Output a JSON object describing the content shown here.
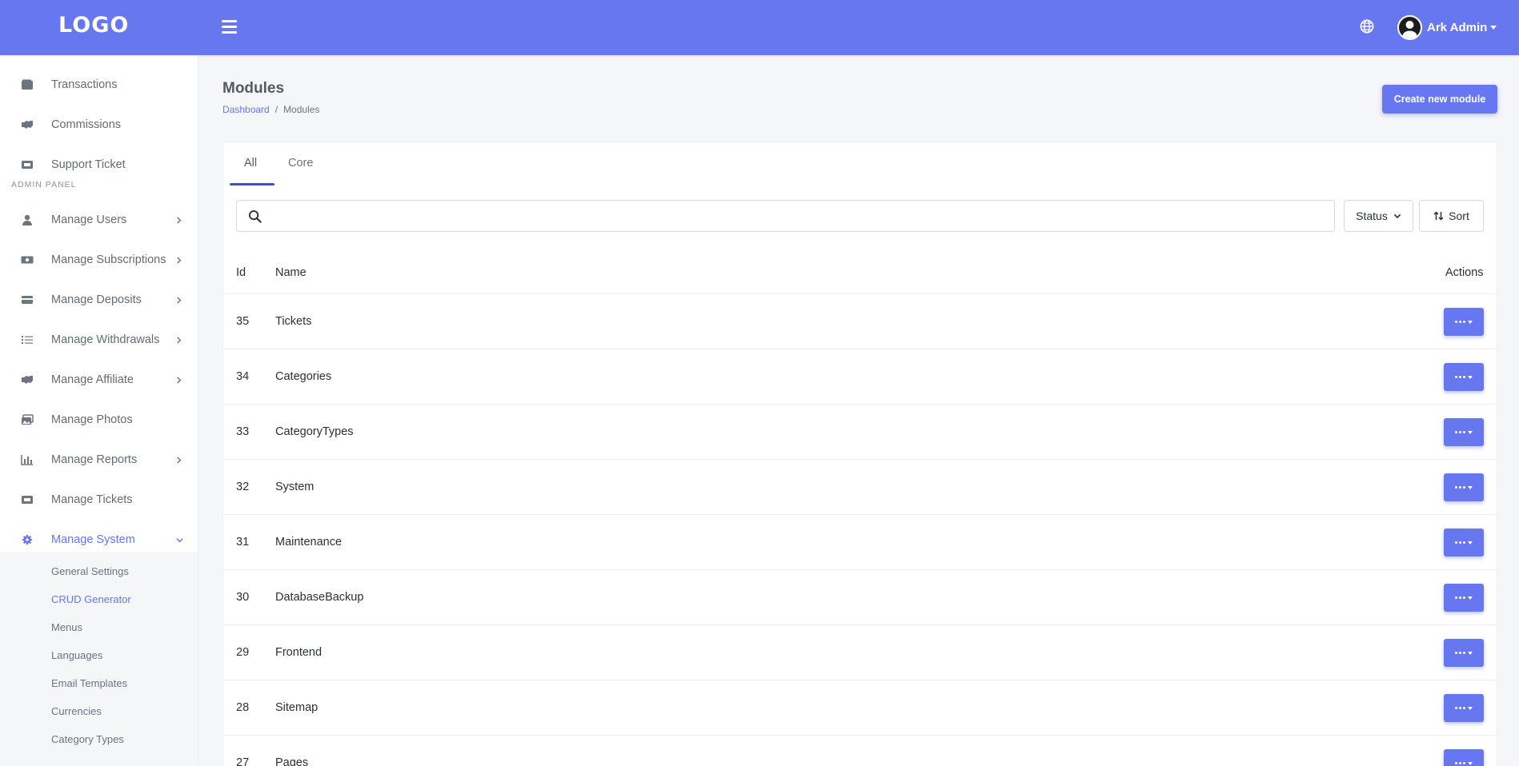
{
  "topbar": {
    "logo": "LOGO",
    "user_name": "Ark Admin",
    "accent": "#6777ef"
  },
  "sidebar": {
    "items_top": [
      {
        "label": "Transactions",
        "icon": "wallet-icon"
      },
      {
        "label": "Commissions",
        "icon": "handshake-icon"
      },
      {
        "label": "Support Ticket",
        "icon": "ticket-icon"
      }
    ],
    "section": "ADMIN PANEL",
    "items": [
      {
        "label": "Manage Users",
        "icon": "user-icon"
      },
      {
        "label": "Manage Subscriptions",
        "icon": "money-icon"
      },
      {
        "label": "Manage Deposits",
        "icon": "credit-card-icon"
      },
      {
        "label": "Manage Withdrawals",
        "icon": "list-icon"
      },
      {
        "label": "Manage Affiliate",
        "icon": "handshake-icon"
      },
      {
        "label": "Manage Photos",
        "icon": "images-icon"
      },
      {
        "label": "Manage Reports",
        "icon": "chart-icon"
      },
      {
        "label": "Manage Tickets",
        "icon": "ticket-icon"
      },
      {
        "label": "Manage System",
        "icon": "gear-icon"
      }
    ],
    "sub_items": [
      "General Settings",
      "CRUD Generator",
      "Menus",
      "Languages",
      "Email Templates",
      "Currencies",
      "Category Types"
    ]
  },
  "page": {
    "title": "Modules",
    "breadcrumb": [
      "Dashboard",
      "Modules"
    ],
    "create_button": "Create new module"
  },
  "tabs": [
    "All",
    "Core"
  ],
  "filters": {
    "search_placeholder": "",
    "status_label": "Status",
    "sort_label": "Sort"
  },
  "table": {
    "headers": [
      "Id",
      "Name",
      "Actions"
    ],
    "rows": [
      {
        "id": "35",
        "name": "Tickets"
      },
      {
        "id": "34",
        "name": "Categories"
      },
      {
        "id": "33",
        "name": "CategoryTypes"
      },
      {
        "id": "32",
        "name": "System"
      },
      {
        "id": "31",
        "name": "Maintenance"
      },
      {
        "id": "30",
        "name": "DatabaseBackup"
      },
      {
        "id": "29",
        "name": "Frontend"
      },
      {
        "id": "28",
        "name": "Sitemap"
      },
      {
        "id": "27",
        "name": "Pages"
      }
    ]
  }
}
